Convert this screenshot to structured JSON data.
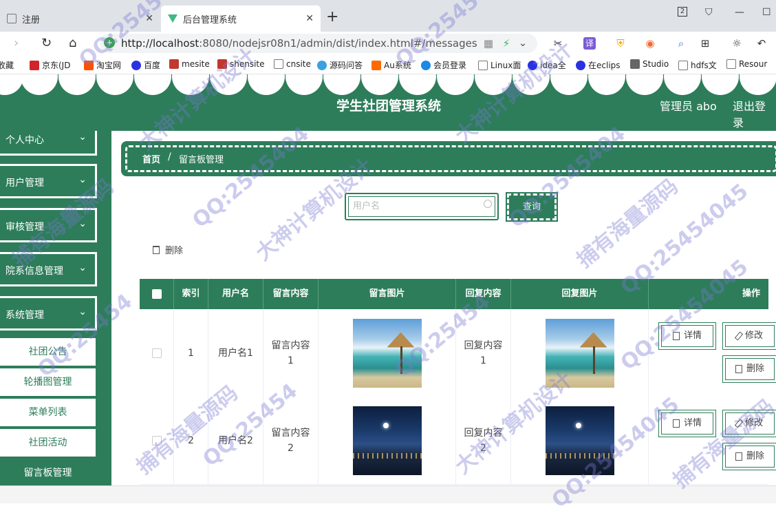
{
  "browser": {
    "tabs": [
      {
        "title": "注册",
        "active": false
      },
      {
        "title": "后台管理系统",
        "active": true
      }
    ],
    "url_host": "http://localhost",
    "url_rest": ":8080/nodejsr08n1/admin/dist/index.html#/messages",
    "tab_count": "2",
    "bookmarks": [
      "收藏",
      "京东(JD",
      "淘宝网",
      "百度",
      "mesite",
      "shensite",
      "cnsite",
      "源码问答",
      "Au系统",
      "会员登录",
      "Linux面",
      "idea全",
      "在eclips",
      "Studio",
      "hdfs文",
      "Resour"
    ]
  },
  "header": {
    "title": "学生社团管理系统",
    "admin": "管理员 abo",
    "logout": "退出登录"
  },
  "sidebar": {
    "groups": [
      {
        "label": "个人中心"
      },
      {
        "label": "用户管理"
      },
      {
        "label": "审核管理"
      },
      {
        "label": "院系信息管理"
      },
      {
        "label": "系统管理"
      }
    ],
    "sub_items": [
      "社团公告",
      "轮播图管理",
      "菜单列表",
      "社团活动",
      "留言板管理"
    ],
    "active_sub": "留言板管理"
  },
  "breadcrumb": {
    "home": "首页",
    "separator": "/",
    "current": "留言板管理"
  },
  "search": {
    "placeholder": "用户名",
    "button": "查询"
  },
  "toolbar": {
    "delete_label": "删除"
  },
  "table": {
    "headers": [
      "索引",
      "用户名",
      "留言内容",
      "留言图片",
      "回复内容",
      "回复图片",
      "操作"
    ],
    "rows": [
      {
        "index": "1",
        "username": "用户名1",
        "content": "留言内容1",
        "image": "tropical-beach",
        "reply": "回复内容1",
        "reply_image": "tropical-beach"
      },
      {
        "index": "2",
        "username": "用户名2",
        "content": "留言内容2",
        "image": "night-city",
        "reply": "回复内容2",
        "reply_image": "night-city"
      }
    ],
    "actions": {
      "detail": "详情",
      "edit": "修改",
      "delete": "删除"
    }
  },
  "watermarks": [
    "QQ:25454",
    "QQ:25454",
    "大神计算机设计",
    "大神计算机设计",
    "QQ:2545404",
    "QQ:2545404",
    "大神计算机设计",
    "QQ:25454045",
    "捕有海量源码",
    "捕有海量源码",
    "QQ:25454",
    "QQ:25454",
    "QQ:25454045",
    "QQ:25454",
    "大神计算机设计",
    "捕有海量源码",
    "捕有海量源码",
    "QQ:25454045"
  ],
  "colors": {
    "primary": "#2d7d5a",
    "white": "#ffffff"
  }
}
